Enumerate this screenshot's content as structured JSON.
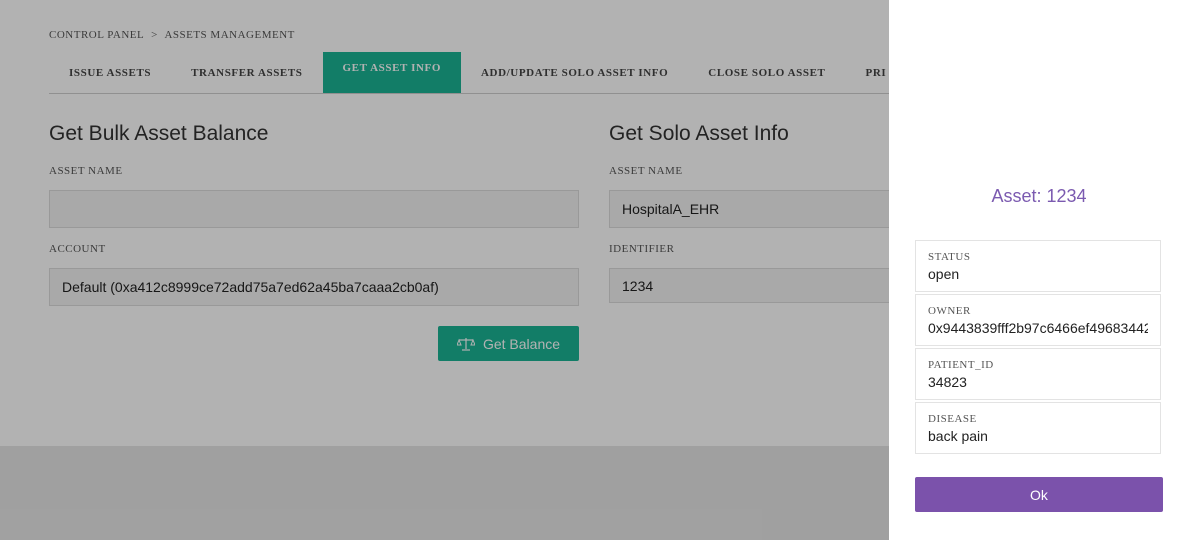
{
  "breadcrumb": {
    "root": "CONTROL PANEL",
    "separator": ">",
    "current": "ASSETS MANAGEMENT"
  },
  "tabs": [
    {
      "label": "ISSUE ASSETS",
      "active": false
    },
    {
      "label": "TRANSFER ASSETS",
      "active": false
    },
    {
      "label": "GET ASSET INFO",
      "active": true
    },
    {
      "label": "ADD/UPDATE SOLO ASSET INFO",
      "active": false
    },
    {
      "label": "CLOSE SOLO ASSET",
      "active": false
    },
    {
      "label": "PRI",
      "active": false
    }
  ],
  "bulk": {
    "title": "Get Bulk Asset Balance",
    "asset_name_label": "ASSET NAME",
    "asset_name_value": "",
    "account_label": "ACCOUNT",
    "account_value": "Default (0xa412c8999ce72add75a7ed62a45ba7caaa2cb0af)",
    "button_label": "Get Balance",
    "button_icon": "balance-scale-icon"
  },
  "solo": {
    "title": "Get Solo Asset Info",
    "asset_name_label": "ASSET NAME",
    "asset_name_value": "HospitalA_EHR",
    "identifier_label": "IDENTIFIER",
    "identifier_value": "1234"
  },
  "modal": {
    "title_prefix": "Asset: ",
    "title_value": "1234",
    "fields": [
      {
        "key": "STATUS",
        "value": "open"
      },
      {
        "key": "OWNER",
        "value": "0x9443839fff2b97c6466ef49683442"
      },
      {
        "key": "PATIENT_ID",
        "value": "34823"
      },
      {
        "key": "DISEASE",
        "value": "back pain"
      }
    ],
    "ok_label": "Ok"
  },
  "colors": {
    "accent_green": "#1ab394",
    "accent_purple": "#7b52ab",
    "title_purple": "#7b5ab0"
  }
}
